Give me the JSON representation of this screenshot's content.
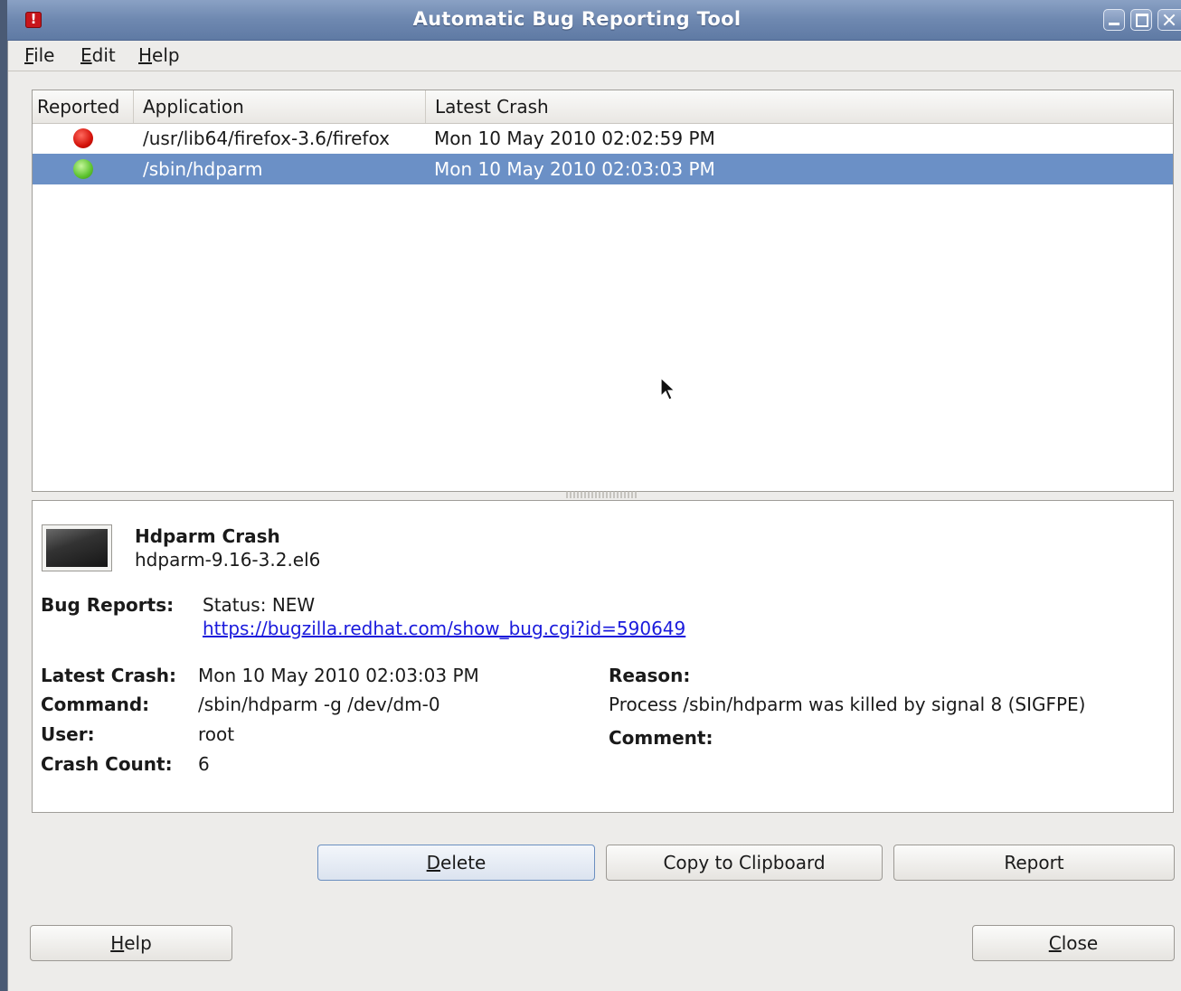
{
  "window": {
    "title": "Automatic Bug Reporting Tool"
  },
  "menu": {
    "file": {
      "mnemonic": "F",
      "rest": "ile"
    },
    "edit": {
      "mnemonic": "E",
      "rest": "dit"
    },
    "help": {
      "mnemonic": "H",
      "rest": "elp"
    }
  },
  "crash_list": {
    "columns": {
      "reported": "Reported",
      "application": "Application",
      "latest_crash": "Latest Crash"
    },
    "rows": [
      {
        "reported_status": "red",
        "application": "/usr/lib64/firefox-3.6/firefox",
        "latest_crash": "Mon 10 May 2010 02:02:59 PM",
        "selected": false
      },
      {
        "reported_status": "green",
        "application": "/sbin/hdparm",
        "latest_crash": "Mon 10 May 2010 02:03:03 PM",
        "selected": true
      }
    ]
  },
  "details": {
    "title": "Hdparm Crash",
    "package": "hdparm-9.16-3.2.el6",
    "bug_reports_label": "Bug Reports:",
    "bug_status": "Status: NEW",
    "bug_url": "https://bugzilla.redhat.com/show_bug.cgi?id=590649",
    "latest_crash_label": "Latest Crash:",
    "latest_crash": "Mon 10 May 2010 02:03:03 PM",
    "command_label": "Command:",
    "command": "/sbin/hdparm -g /dev/dm-0",
    "user_label": "User:",
    "user": "root",
    "crash_count_label": "Crash Count:",
    "crash_count": "6",
    "reason_label": "Reason:",
    "reason": "Process /sbin/hdparm was killed by signal 8 (SIGFPE)",
    "comment_label": "Comment:"
  },
  "buttons": {
    "delete": {
      "mnemonic": "D",
      "rest": "elete"
    },
    "copy": "Copy to Clipboard",
    "report": "Report",
    "help": {
      "mnemonic": "H",
      "rest": "elp"
    },
    "close": {
      "mnemonic": "C",
      "rest": "lose"
    }
  },
  "colors": {
    "title_bar": "#6e88b0",
    "selection": "#6b90c6",
    "link": "#1a1adc"
  }
}
